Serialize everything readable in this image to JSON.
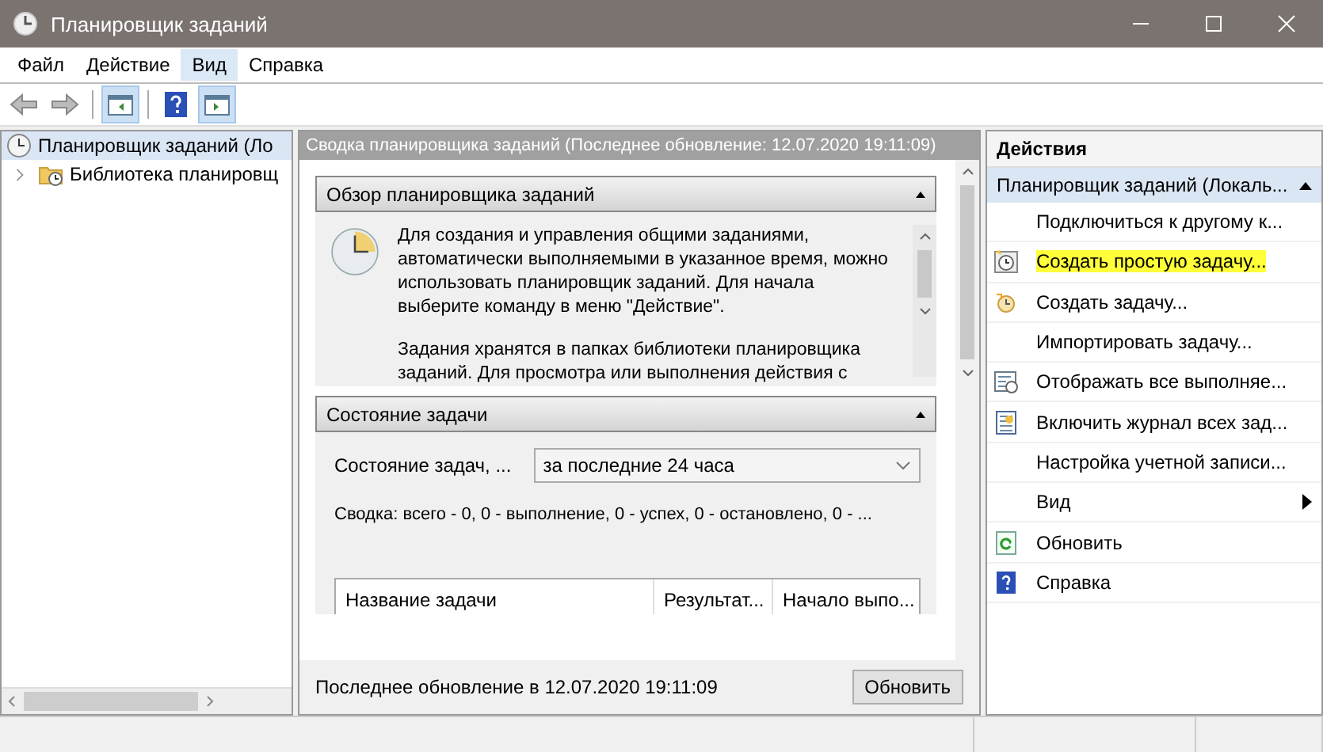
{
  "window": {
    "title": "Планировщик заданий"
  },
  "menu": [
    {
      "label": "Файл",
      "selected": false
    },
    {
      "label": "Действие",
      "selected": false
    },
    {
      "label": "Вид",
      "selected": true
    },
    {
      "label": "Справка",
      "selected": false
    }
  ],
  "toolbar": [
    {
      "kind": "back",
      "selected": false
    },
    {
      "kind": "forward",
      "selected": false
    },
    {
      "kind": "pane-left",
      "selected": true
    },
    {
      "kind": "help",
      "selected": false
    },
    {
      "kind": "pane-right",
      "selected": true
    }
  ],
  "tree": [
    {
      "label": "Планировщик заданий (Ло",
      "selected": true,
      "children": [
        {
          "label": "Библиотека планировщ",
          "selected": false,
          "expanded": false
        }
      ]
    }
  ],
  "summary": {
    "title": "Сводка планировщика заданий (Последнее обновление: 12.07.2020 19:11:09)",
    "overview": {
      "title": "Обзор планировщика заданий",
      "paragraphs": [
        "Для создания и управления общими заданиями, автоматически выполняемыми в указанное время, можно использовать планировщик заданий. Для начала выберите команду в меню \"Действие\".",
        "Задания хранятся в папках библиотеки планировщика заданий. Для просмотра или выполнения действия с"
      ]
    },
    "status": {
      "title": "Состояние задачи",
      "filter_label": "Состояние задач, ...",
      "filter_value": "за последние 24 часа",
      "totals": "Сводка: всего - 0, 0 - выполнение, 0 - успех, 0 - остановлено, 0 - ...",
      "columns": [
        "Название задачи",
        "Результат...",
        "Начало выпо..."
      ]
    },
    "footer": {
      "text": "Последнее обновление в 12.07.2020 19:11:09",
      "button": "Обновить"
    }
  },
  "actions": {
    "title": "Действия",
    "group": {
      "title": "Планировщик заданий (Локаль...",
      "expanded": true
    },
    "items": [
      {
        "label": "Подключиться к другому к...",
        "kind": "plain",
        "highlighted": false,
        "submenu": false
      },
      {
        "label": "Создать простую задачу...",
        "kind": "wizard",
        "highlighted": true,
        "submenu": false
      },
      {
        "label": "Создать задачу...",
        "kind": "task",
        "highlighted": false,
        "submenu": false
      },
      {
        "label": "Импортировать задачу...",
        "kind": "plain",
        "highlighted": false,
        "submenu": false
      },
      {
        "label": "Отображать все выполняе...",
        "kind": "list",
        "highlighted": false,
        "submenu": false
      },
      {
        "label": "Включить журнал всех зад...",
        "kind": "log",
        "highlighted": false,
        "submenu": false
      },
      {
        "label": "Настройка учетной записи...",
        "kind": "plain",
        "highlighted": false,
        "submenu": false
      },
      {
        "label": "Вид",
        "kind": "plain",
        "highlighted": false,
        "submenu": true
      },
      {
        "label": "Обновить",
        "kind": "refresh",
        "highlighted": false,
        "submenu": false
      },
      {
        "label": "Справка",
        "kind": "help",
        "highlighted": false,
        "submenu": false
      }
    ]
  }
}
